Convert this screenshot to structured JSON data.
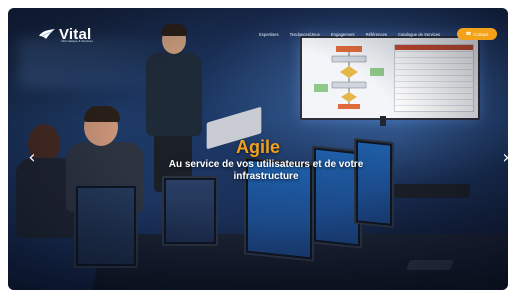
{
  "brand": {
    "name": "Vital",
    "tagline": "Informatique & Services",
    "logo_icon": "bird-icon"
  },
  "nav": {
    "items": [
      {
        "label": "Expertises"
      },
      {
        "label": "Tendances/Jeux"
      },
      {
        "label": "Engagement"
      },
      {
        "label": "Références"
      },
      {
        "label": "Catalogue de Services"
      }
    ],
    "contact_label": "Contact",
    "contact_icon": "phone-icon",
    "contact_color": "#f3a21a"
  },
  "hero": {
    "title": "Agile",
    "subtitle": "Au service de vos utilisateurs et de votre infrastructure",
    "title_color": "#f2a019",
    "prev_icon": "chevron-left-icon",
    "next_icon": "chevron-right-icon",
    "prev_glyph": "‹",
    "next_glyph": "›"
  }
}
